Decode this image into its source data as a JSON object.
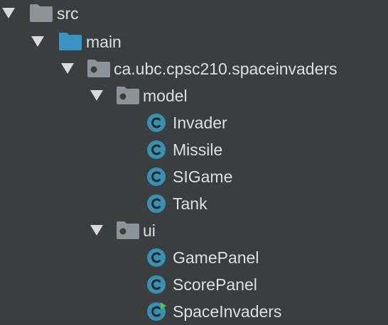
{
  "tree": {
    "src": {
      "label": "src",
      "icon": "folder-icon"
    },
    "main": {
      "label": "main",
      "icon": "source-folder-icon"
    },
    "package": {
      "label": "ca.ubc.cpsc210.spaceinvaders",
      "icon": "package-icon"
    },
    "model": {
      "label": "model",
      "icon": "package-icon",
      "classes": [
        {
          "label": "Invader",
          "icon": "class-icon"
        },
        {
          "label": "Missile",
          "icon": "class-icon"
        },
        {
          "label": "SIGame",
          "icon": "class-icon"
        },
        {
          "label": "Tank",
          "icon": "class-icon"
        }
      ]
    },
    "ui": {
      "label": "ui",
      "icon": "package-icon",
      "classes": [
        {
          "label": "GamePanel",
          "icon": "class-icon"
        },
        {
          "label": "ScorePanel",
          "icon": "class-icon"
        },
        {
          "label": "SpaceInvaders",
          "icon": "runnable-class-icon"
        }
      ]
    }
  },
  "colors": {
    "background": "#3b3e40",
    "text": "#dcdfe3",
    "folder_gray": "#8d9499",
    "folder_blue": "#3b95c4",
    "class_circle": "#3b8fb0",
    "run_badge": "#5cc04b"
  }
}
